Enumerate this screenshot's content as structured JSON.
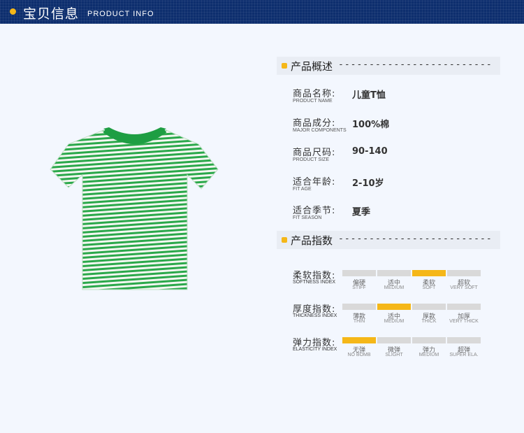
{
  "header": {
    "title_cn": "宝贝信息",
    "title_en": "PRODUCT INFO"
  },
  "overview": {
    "title": "产品概述",
    "dashes": "-------------------------",
    "rows": [
      {
        "label": "商品名称:",
        "label_en": "PRODUCT NAME",
        "value": "儿童T恤"
      },
      {
        "label": "商品成分:",
        "label_en": "MAJOR COMPONENTS",
        "value": "100%棉"
      },
      {
        "label": "商品尺码:",
        "label_en": "PRODUCT SIZE",
        "value": "90-140"
      },
      {
        "label": "适合年龄:",
        "label_en": "FIT AGE",
        "value": "2-10岁"
      },
      {
        "label": "适合季节:",
        "label_en": "FIT SEASON",
        "value": "夏季"
      }
    ]
  },
  "indices": {
    "title": "产品指数",
    "dashes": "-------------------------",
    "highlight_color": "#f5b718",
    "rows": [
      {
        "label": "柔软指数:",
        "label_en": "SOFTNESS INDEX",
        "selected_index": 2,
        "levels": [
          {
            "cn": "偏硬",
            "en": "STIFF"
          },
          {
            "cn": "适中",
            "en": "MEDIUM"
          },
          {
            "cn": "柔软",
            "en": "SOFT"
          },
          {
            "cn": "超软",
            "en": "VERY SOFT"
          }
        ]
      },
      {
        "label": "厚度指数:",
        "label_en": "THICKNESS INDEX",
        "selected_index": 1,
        "levels": [
          {
            "cn": "薄款",
            "en": "THIN"
          },
          {
            "cn": "适中",
            "en": "MEDIUM"
          },
          {
            "cn": "厚款",
            "en": "THICK"
          },
          {
            "cn": "加厚",
            "en": "VERY THICK"
          }
        ]
      },
      {
        "label": "弹力指数:",
        "label_en": "ELASTICITY INDEX",
        "selected_index": 0,
        "levels": [
          {
            "cn": "无弹",
            "en": "NO BOMB"
          },
          {
            "cn": "微弹",
            "en": "SLIGHT"
          },
          {
            "cn": "弹力",
            "en": "MEDIUM"
          },
          {
            "cn": "超弹",
            "en": "SUPER ELA."
          }
        ]
      }
    ]
  },
  "product_image": {
    "icon": "striped-tshirt-icon",
    "color": "#2aa84a",
    "collar_color": "#1e9e43"
  }
}
